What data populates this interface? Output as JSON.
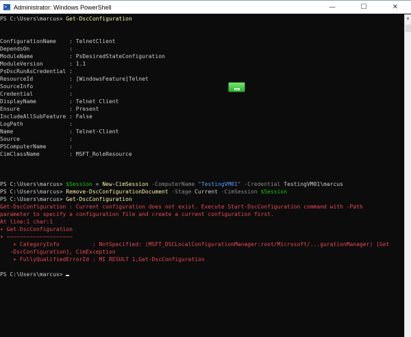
{
  "window": {
    "title": "Administrator: Windows PowerShell",
    "minimize_icon": "minimize-icon",
    "maximize_icon": "maximize-icon",
    "close_icon": "close-icon"
  },
  "colors": {
    "background": "#0c0c0c",
    "text": "#cccccc",
    "command": "#f9f1a5",
    "parameter": "#8a8a8a",
    "string": "#5b9bff",
    "variable": "#16c60c",
    "error": "#e74856"
  },
  "terminal": {
    "lines": [
      [
        {
          "t": "PS C:\\Users\\marcus> ",
          "c": "default"
        },
        {
          "t": "Get-DscConfiguration",
          "c": "yellow"
        }
      ],
      [],
      [],
      [
        {
          "t": "ConfigurationName    : TelnetClient",
          "c": "default"
        }
      ],
      [
        {
          "t": "DependsOn            :",
          "c": "default"
        }
      ],
      [
        {
          "t": "ModuleName           : PsDesiredStateConfiguration",
          "c": "default"
        }
      ],
      [
        {
          "t": "ModuleVersion        : 1.1",
          "c": "default"
        }
      ],
      [
        {
          "t": "PsDscRunAsCredential :",
          "c": "default"
        }
      ],
      [
        {
          "t": "ResourceId           : [WindowsFeature]Telnet",
          "c": "default"
        }
      ],
      [
        {
          "t": "SourceInfo           :",
          "c": "default"
        }
      ],
      [
        {
          "t": "Credential           :",
          "c": "default"
        }
      ],
      [
        {
          "t": "DisplayName          : Telnet Client",
          "c": "default"
        }
      ],
      [
        {
          "t": "Ensure               : Present",
          "c": "default"
        }
      ],
      [
        {
          "t": "IncludeAllSubFeature : False",
          "c": "default"
        }
      ],
      [
        {
          "t": "LogPath              :",
          "c": "default"
        }
      ],
      [
        {
          "t": "Name                 : Telnet-Client",
          "c": "default"
        }
      ],
      [
        {
          "t": "Source               :",
          "c": "default"
        }
      ],
      [
        {
          "t": "PSComputerName       :",
          "c": "default"
        }
      ],
      [
        {
          "t": "CimClassName         : MSFT_RoleResource",
          "c": "default"
        }
      ],
      [],
      [],
      [],
      [
        {
          "t": "PS C:\\Users\\marcus> ",
          "c": "default"
        },
        {
          "t": "$Session",
          "c": "green"
        },
        {
          "t": " = ",
          "c": "default"
        },
        {
          "t": "New-CimSession",
          "c": "yellow"
        },
        {
          "t": " -ComputerName ",
          "c": "gray"
        },
        {
          "t": "\"TestingVM01\"",
          "c": "blue"
        },
        {
          "t": " -Credential ",
          "c": "gray"
        },
        {
          "t": "TestingVM01\\marcus",
          "c": "default"
        }
      ],
      [
        {
          "t": "PS C:\\Users\\marcus> ",
          "c": "default"
        },
        {
          "t": "Remove-DscConfigurationDocument",
          "c": "yellow"
        },
        {
          "t": " -Stage ",
          "c": "gray"
        },
        {
          "t": "Current",
          "c": "default"
        },
        {
          "t": " -CimSession ",
          "c": "gray"
        },
        {
          "t": "$Session",
          "c": "green"
        }
      ],
      [
        {
          "t": "PS C:\\Users\\marcus> ",
          "c": "default"
        },
        {
          "t": "Get-DscConfiguration",
          "c": "yellow"
        }
      ],
      [
        {
          "t": "Get-DscConfiguration : Current configuration does not exist. Execute Start-DscConfiguration command with -Path",
          "c": "red"
        }
      ],
      [
        {
          "t": "parameter to specify a configuration file and create a current configuration first.",
          "c": "red"
        }
      ],
      [
        {
          "t": "At line:1 char:1",
          "c": "red"
        }
      ],
      [
        {
          "t": "+ Get-DscConfiguration",
          "c": "red"
        }
      ],
      [
        {
          "t": "+ ~~~~~~~~~~~~~~~~~~~~",
          "c": "red"
        }
      ],
      [
        {
          "t": "    + CategoryInfo          : NotSpecified: (MSFT_DSCLocalConfigurationManager:root/Microsoft/...gurationManager) [Get",
          "c": "red"
        }
      ],
      [
        {
          "t": "   -DscConfiguration], CimException",
          "c": "red"
        }
      ],
      [
        {
          "t": "    + FullyQualifiedErrorId : MI RESULT 1,Get-DscConfiguration",
          "c": "red"
        }
      ],
      [],
      [
        {
          "t": "PS C:\\Users\\marcus> ",
          "c": "default"
        }
      ]
    ]
  }
}
